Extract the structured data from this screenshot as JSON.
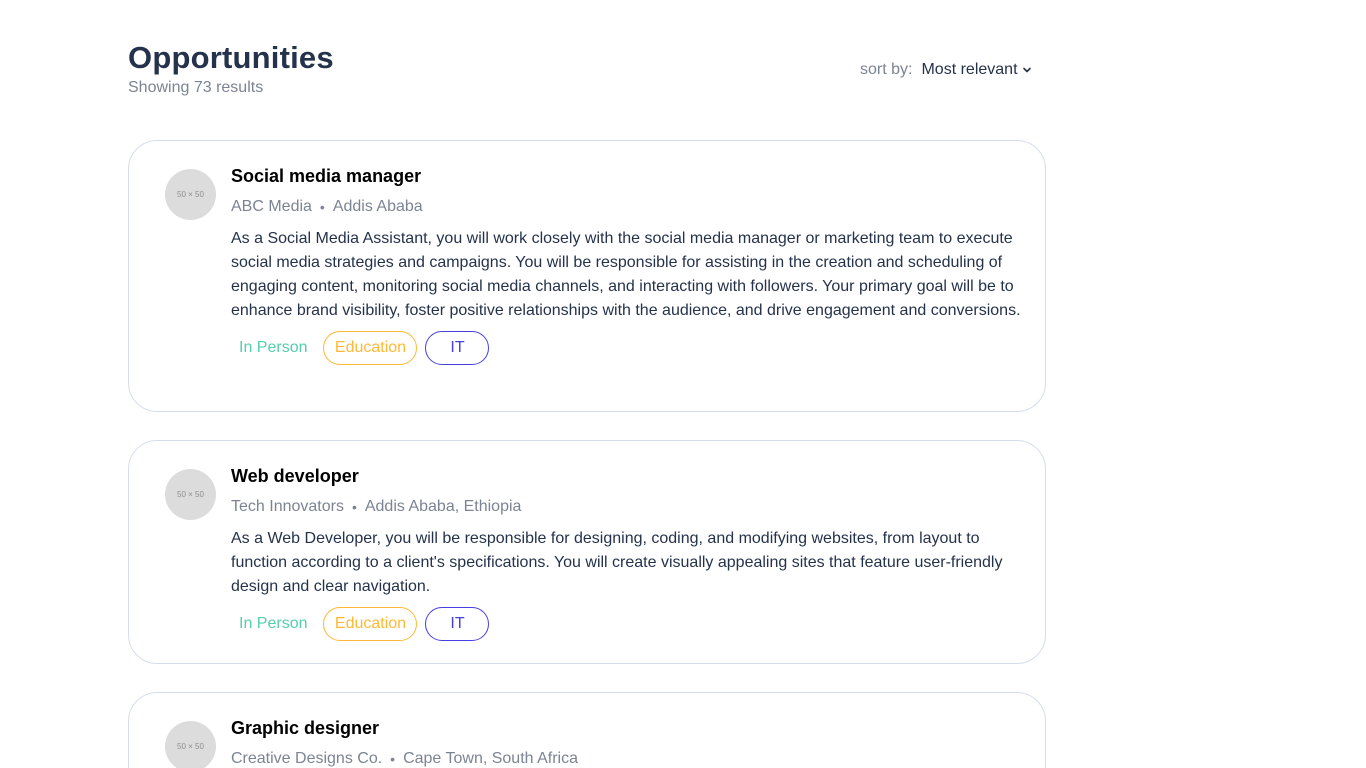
{
  "header": {
    "title": "Opportunities",
    "results_text": "Showing 73 results",
    "sort_label": "sort by:",
    "sort_value": "Most relevant"
  },
  "jobs": [
    {
      "title": "Social media manager",
      "company": "ABC Media",
      "location": "Addis Ababa",
      "logo_text": "50 × 50",
      "description": "As a Social Media Assistant, you will work closely with the social media manager or marketing team to execute social media strategies and campaigns. You will be responsible for assisting in the creation and scheduling of engaging content, monitoring social media channels, and interacting with followers. Your primary goal will be to enhance brand visibility, foster positive relationships with the audience, and drive engagement and conversions.",
      "tags": [
        "In Person",
        "Education",
        "IT"
      ]
    },
    {
      "title": "Web developer",
      "company": "Tech Innovators",
      "location": "Addis Ababa, Ethiopia",
      "logo_text": "50 × 50",
      "description": "As a Web Developer, you will be responsible for designing, coding, and modifying websites, from layout to function according to a client's specifications. You will create visually appealing sites that feature user-friendly design and clear navigation.",
      "tags": [
        "In Person",
        "Education",
        "IT"
      ]
    },
    {
      "title": "Graphic designer",
      "company": "Creative Designs Co.",
      "location": "Cape Town, South Africa",
      "logo_text": "50 × 50",
      "description": "",
      "tags": []
    }
  ],
  "colors": {
    "in_person": "#56cdad",
    "education": "#ffb836",
    "it": "#4640de",
    "title": "#25324b",
    "muted": "#7c8493",
    "border": "#d6ddeb"
  }
}
